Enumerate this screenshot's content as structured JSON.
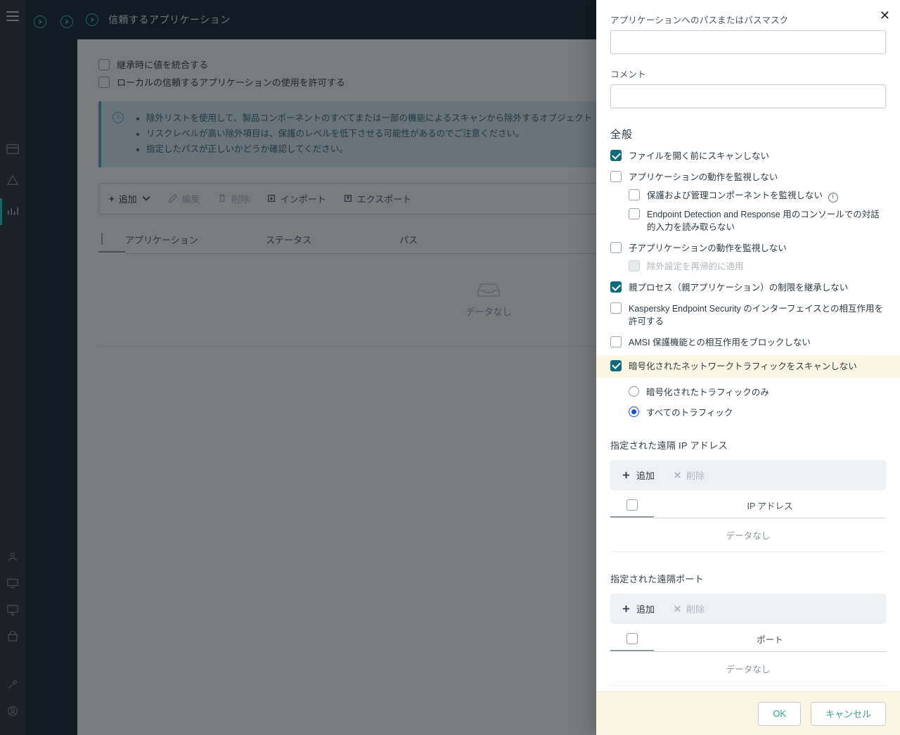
{
  "title": "信頼するアプリケーション",
  "left_nav_active_index": 3,
  "main": {
    "cb_merge": "継承時に値を統合する",
    "cb_allow_local": "ローカルの信頼するアプリケーションの使用を許可する",
    "info": [
      "除外リストを使用して、製品コンポーネントのすべてまたは一部の機能によるスキャンから除外するオブジェクト（ウイルス百科事典に従います）を指定できます。",
      "リスクレベルが高い除外項目は、保護のレベルを低下させる可能性があるのでご注意ください。",
      "指定したパスが正しいかどうか確認してください。"
    ],
    "toolbar": {
      "add": "追加",
      "edit": "編集",
      "delete": "削除",
      "import": "インポート",
      "export": "エクスポート"
    },
    "table": {
      "cols": {
        "app": "アプリケーション",
        "status": "ステータス",
        "path": "パス"
      },
      "empty": "データなし"
    }
  },
  "panel": {
    "path_label": "アプリケーションへのパスまたはパスマスク",
    "path_value": "",
    "comment_label": "コメント",
    "comment_value": "",
    "general_section": "全般",
    "checks": {
      "scan_before_open": "ファイルを開く前にスキャンしない",
      "monitor_app": "アプリケーションの動作を監視しない",
      "monitor_protect": "保護および管理コンポーネントを監視しない",
      "edr_console": "Endpoint Detection and Response 用のコンソールでの対話的入力を読み取らない",
      "monitor_child": "子アプリケーションの動作を監視しない",
      "apply_recursive": "除外設定を再帰的に適用",
      "inherit_parent": "親プロセス（親アプリケーション）の制限を継承しない",
      "kes_interface": "Kaspersky Endpoint Security のインターフェイスとの相互作用を許可する",
      "amsi": "AMSI 保護機能との相互作用をブロックしない",
      "encrypted": "暗号化されたネットワークトラフィックをスキャンしない"
    },
    "radios": {
      "encrypted_only": "暗号化されたトラフィックのみ",
      "all_traffic": "すべてのトラフィック"
    },
    "remote_ip": {
      "title": "指定された遠隔 IP アドレス",
      "add": "追加",
      "del": "削除",
      "col": "IP アドレス",
      "empty": "データなし"
    },
    "remote_port": {
      "title": "指定された遠隔ポート",
      "add": "追加",
      "del": "削除",
      "col": "ポート",
      "empty": "データなし"
    },
    "footer": {
      "ok": "OK",
      "cancel": "キャンセル"
    }
  }
}
